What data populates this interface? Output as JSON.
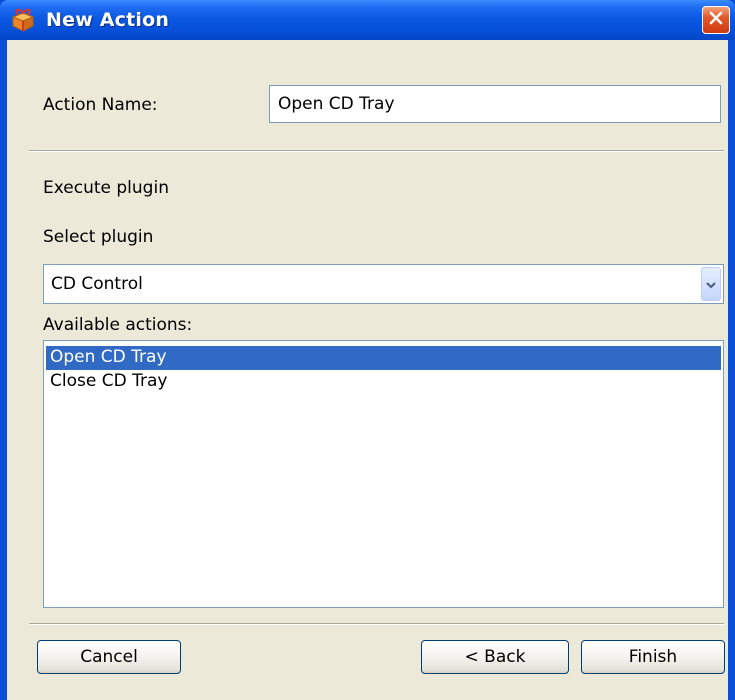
{
  "window": {
    "title": "New Action",
    "icon": "gift-box-icon",
    "close_icon": "close-icon"
  },
  "form": {
    "action_name_label": "Action Name:",
    "action_name_value": "Open CD Tray",
    "execute_plugin_label": "Execute plugin",
    "select_plugin_label": "Select plugin",
    "plugin_selected": "CD Control",
    "available_actions_label": "Available actions:",
    "available_actions": [
      {
        "label": "Open CD Tray",
        "selected": true
      },
      {
        "label": "Close CD Tray",
        "selected": false
      }
    ]
  },
  "buttons": {
    "cancel": "Cancel",
    "back": "< Back",
    "finish": "Finish"
  },
  "colors": {
    "titlebar": "#0650d8",
    "selection": "#316ac5",
    "dialog_bg": "#ece9d8"
  }
}
